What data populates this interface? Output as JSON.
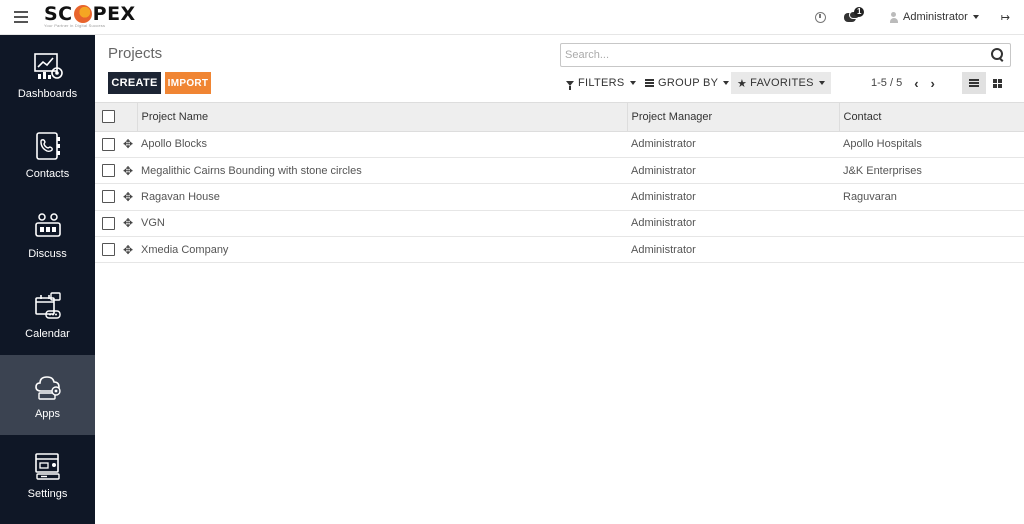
{
  "app": {
    "logo_prefix": "SC",
    "logo_suffix": "PEX",
    "logo_tagline": "Your Partner in Digital Success"
  },
  "header": {
    "notification_count": "1",
    "user_name": "Administrator"
  },
  "sidebar": {
    "items": [
      {
        "label": "Dashboards"
      },
      {
        "label": "Contacts"
      },
      {
        "label": "Discuss"
      },
      {
        "label": "Calendar"
      },
      {
        "label": "Apps"
      },
      {
        "label": "Settings"
      }
    ],
    "active": "Apps"
  },
  "control_panel": {
    "breadcrumb": "Projects",
    "search_placeholder": "Search...",
    "create_label": "CREATE",
    "import_label": "IMPORT",
    "filters_label": "FILTERS",
    "group_by_label": "GROUP BY",
    "favorites_label": "FAVORITES",
    "pager": "1-5 / 5"
  },
  "table": {
    "columns": [
      "Project Name",
      "Project Manager",
      "Contact"
    ],
    "rows": [
      {
        "name": "Apollo Blocks",
        "manager": "Administrator",
        "contact": "Apollo Hospitals"
      },
      {
        "name": "Megalithic Cairns Bounding with stone circles",
        "manager": "Administrator",
        "contact": "J&K Enterprises"
      },
      {
        "name": "Ragavan House",
        "manager": "Administrator",
        "contact": "Raguvaran"
      },
      {
        "name": "VGN",
        "manager": "Administrator",
        "contact": ""
      },
      {
        "name": "Xmedia Company",
        "manager": "Administrator",
        "contact": ""
      }
    ]
  },
  "colors": {
    "sidebar_bg": "#0f1726",
    "sidebar_active": "#3b4351",
    "create_button": "#1c2433",
    "import_button": "#f08533",
    "logo_accent": "#e8642c"
  }
}
